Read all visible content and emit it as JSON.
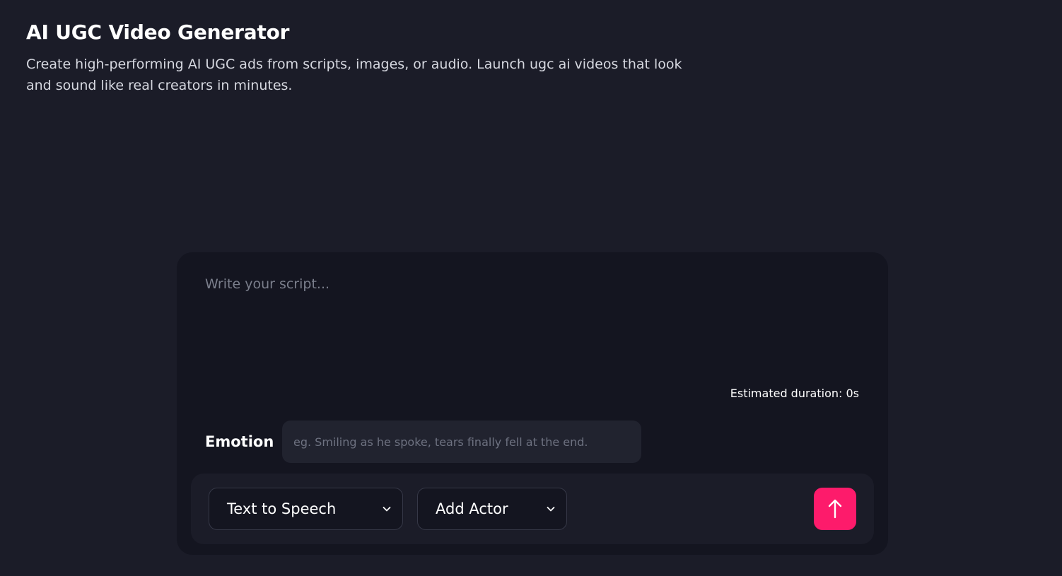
{
  "header": {
    "title": "AI UGC Video Generator",
    "description": "Create high-performing AI UGC ads from scripts, images, or audio. Launch ugc ai videos that look and sound like real creators in minutes."
  },
  "composer": {
    "script_placeholder": "Write your script...",
    "script_value": "",
    "duration_text": "Estimated duration: 0s",
    "emotion_label": "Emotion",
    "emotion_placeholder": "eg. Smiling as he spoke, tears finally fell at the end.",
    "emotion_value": ""
  },
  "toolbar": {
    "mode_select_label": "Text to Speech",
    "actor_select_label": "Add Actor",
    "send_icon": "arrow-up-icon",
    "chevron_icon": "chevron-down-icon"
  },
  "colors": {
    "page_bg": "#1b1c28",
    "panel_bg": "#141520",
    "accent": "#fd1b6b"
  }
}
